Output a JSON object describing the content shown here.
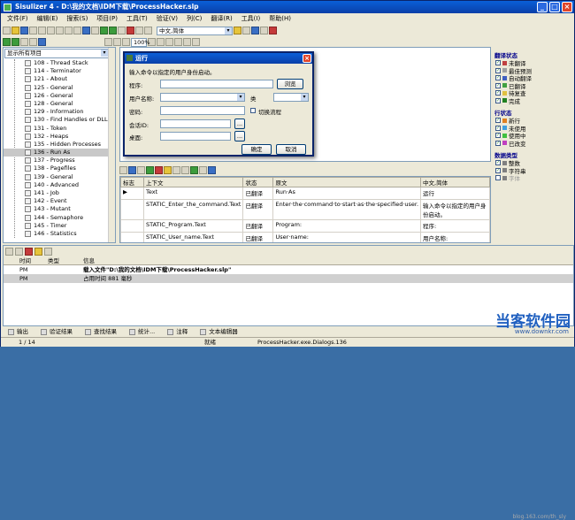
{
  "window": {
    "title": "Sisulizer 4 - D:\\我的文档\\IDM下载\\ProcessHacker.slp"
  },
  "menu": [
    "文件(F)",
    "编辑(E)",
    "搜索(S)",
    "项目(P)",
    "工具(T)",
    "验证(V)",
    "列(C)",
    "翻译(R)",
    "工具(I)",
    "帮助(H)"
  ],
  "toolbar": {
    "zoom": "100%",
    "language": "中文,简体"
  },
  "tree": {
    "filter": "显示所有项目",
    "items": [
      "108 - Thread Stack",
      "114 - Terminator",
      "121 - About",
      "125 - General",
      "126 - General",
      "128 - General",
      "129 - Information",
      "130 - Find Handles or DLLs",
      "131 - Token",
      "132 - Heaps",
      "135 - Hidden Processes",
      "136 - Run As",
      "137 - Progress",
      "138 - Pagefiles",
      "139 - General",
      "140 - Advanced",
      "141 - Job",
      "142 - Event",
      "143 - Mutant",
      "144 - Semaphore",
      "145 - Timer",
      "146 - Statistics"
    ],
    "selected": 11
  },
  "dialog": {
    "title": "运行",
    "desc": "输入命令以指定的用户身份启动。",
    "program": "程序:",
    "browse": "浏览",
    "username": "用户名称:",
    "type": "类",
    "password": "密码:",
    "toggle": "切换流程",
    "session": "会话ID:",
    "desktop": "桌面:",
    "ok": "确定",
    "cancel": "取消",
    "ellipsis": "..."
  },
  "right": {
    "trans_status": "翻译状态",
    "trans_items": [
      "未翻译",
      "最佳预测",
      "自动翻译",
      "已翻译",
      "待复查",
      "完成"
    ],
    "row_status": "行状态",
    "row_items": [
      "新行",
      "未使用",
      "使用中",
      "已改变"
    ],
    "data_type": "数据类型",
    "data_items": [
      "整数",
      "字符串",
      "字体"
    ]
  },
  "grid": {
    "headers": [
      "标志",
      "上下文",
      "状态",
      "原文",
      "中文,简体"
    ],
    "rows": [
      [
        "Text",
        "已翻译",
        "Run·As",
        "运行"
      ],
      [
        "STATIC_Enter_the_command.Text",
        "已翻译",
        "Enter·the·command·to·start·as·the·specified·user.",
        "输入命令以指定的用户身份启动。"
      ],
      [
        "STATIC_Program.Text",
        "已翻译",
        "Program:",
        "程序:"
      ],
      [
        "STATIC_User_name.Text",
        "已翻译",
        "User·name:",
        "用户名称:"
      ]
    ]
  },
  "log": {
    "headers": [
      "时间",
      "类型",
      "信息"
    ],
    "rows": [
      [
        "PM",
        "",
        "载入文件\"D:\\我的文档\\IDM下载\\ProcessHacker.slp\""
      ],
      [
        "PM",
        "",
        "占用时间 881 毫秒"
      ]
    ]
  },
  "tabs": [
    "输出",
    "验证结果",
    "查找结果",
    "统计...",
    "注释",
    "文本编辑器"
  ],
  "status": {
    "page": "1 / 14",
    "state": "就绪",
    "path": "ProcessHacker.exe.Dialogs.136"
  },
  "watermark": {
    "brand": "当客软件园",
    "url": "www.downkr.com",
    "blog": "blog.163.com/th_sly"
  }
}
